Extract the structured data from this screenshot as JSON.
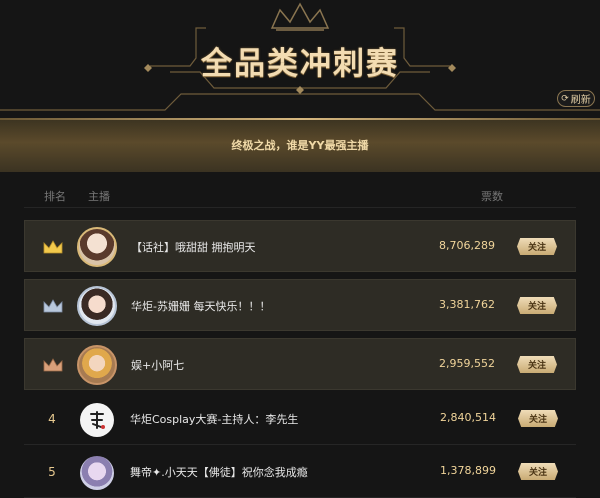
{
  "header": {
    "title": "全品类冲刺赛",
    "refresh_label": "刷新",
    "refresh_icon": "refresh-icon"
  },
  "banner": {
    "text": "终极之战，谁是YY最强主播"
  },
  "columns": {
    "rank": "排名",
    "host": "主播",
    "votes": "票数"
  },
  "follow_label": "关注",
  "rows": [
    {
      "rank": "",
      "rank_icon": "gold-crown-icon",
      "name": "【话社】哦甜甜 拥抱明天",
      "votes": "8,706,289"
    },
    {
      "rank": "",
      "rank_icon": "silver-crown-icon",
      "name": "华炬-苏姗姗 每天快乐！！！",
      "votes": "3,381,762"
    },
    {
      "rank": "",
      "rank_icon": "bronze-crown-icon",
      "name": "娱+小阿七",
      "votes": "2,959,552"
    },
    {
      "rank": "4",
      "name": "华炬Cosplay大赛-主持人：李先生",
      "votes": "2,840,514"
    },
    {
      "rank": "5",
      "name": "舞帝✦.小天天【佛徒】祝你念我成瘾",
      "votes": "1,378,899"
    }
  ],
  "colors": {
    "accent": "#e6c88f",
    "title": "#f3dcb2",
    "background": "#151515"
  }
}
